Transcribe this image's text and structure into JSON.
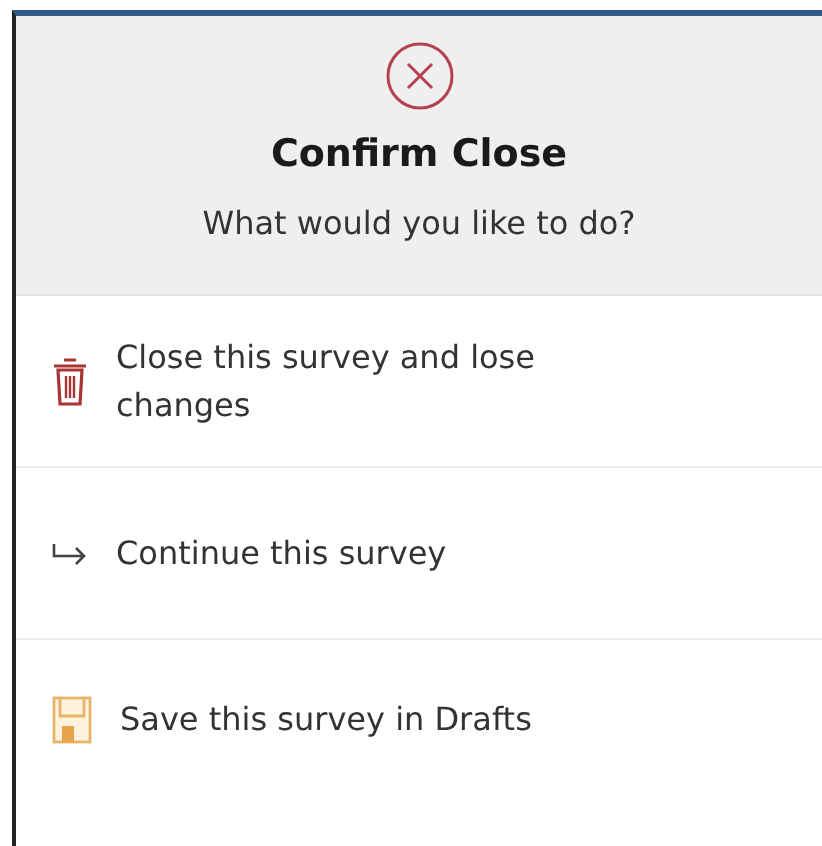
{
  "dialog": {
    "title": "Confirm Close",
    "message": "What would you like to do?"
  },
  "options": [
    {
      "kind": "delete",
      "label": "Close this survey and lose changes"
    },
    {
      "kind": "continue",
      "label": "Continue this survey"
    },
    {
      "kind": "save",
      "label": "Save this survey in Drafts"
    }
  ]
}
